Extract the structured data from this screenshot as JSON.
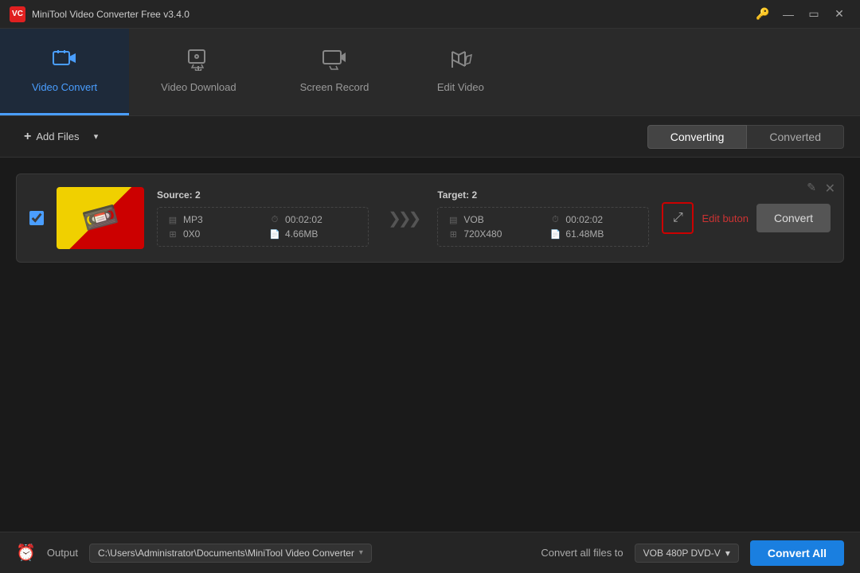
{
  "app": {
    "title": "MiniTool Video Converter Free v3.4.0",
    "logo_text": "VC"
  },
  "titlebar": {
    "controls": {
      "key_label": "🔑",
      "minimize_label": "—",
      "maximize_label": "▭",
      "close_label": "✕"
    }
  },
  "navbar": {
    "tabs": [
      {
        "id": "video-convert",
        "label": "Video Convert",
        "icon": "⊡",
        "active": true
      },
      {
        "id": "video-download",
        "label": "Video Download",
        "icon": "⬇",
        "active": false
      },
      {
        "id": "screen-record",
        "label": "Screen Record",
        "icon": "▶",
        "active": false
      },
      {
        "id": "edit-video",
        "label": "Edit Video",
        "icon": "🎬",
        "active": false
      }
    ]
  },
  "toolbar": {
    "add_files_label": "Add Files",
    "converting_label": "Converting",
    "converted_label": "Converted"
  },
  "file_card": {
    "source_label": "Source:",
    "source_count": "2",
    "target_label": "Target:",
    "target_count": "2",
    "source": {
      "format": "MP3",
      "duration": "00:02:02",
      "resolution": "0X0",
      "size": "4.66MB"
    },
    "target": {
      "format": "VOB",
      "duration": "00:02:02",
      "resolution": "720X480",
      "size": "61.48MB"
    },
    "edit_label": "Edit buton",
    "convert_label": "Convert"
  },
  "bottombar": {
    "output_label": "Output",
    "output_path": "C:\\Users\\Administrator\\Documents\\MiniTool Video Converter",
    "convert_all_files_label": "Convert all files to",
    "format_label": "VOB 480P DVD-V",
    "convert_all_label": "Convert All"
  },
  "icons": {
    "add_plus": "+",
    "dropdown_arrow": "▾",
    "arrows_right": "❯❯❯",
    "edit_top": "✎",
    "close": "✕",
    "expand": "⤢",
    "clock": "⏰",
    "format_icon": "▤",
    "duration_icon": "⏱",
    "resolution_icon": "⊞",
    "filesize_icon": "📄"
  }
}
